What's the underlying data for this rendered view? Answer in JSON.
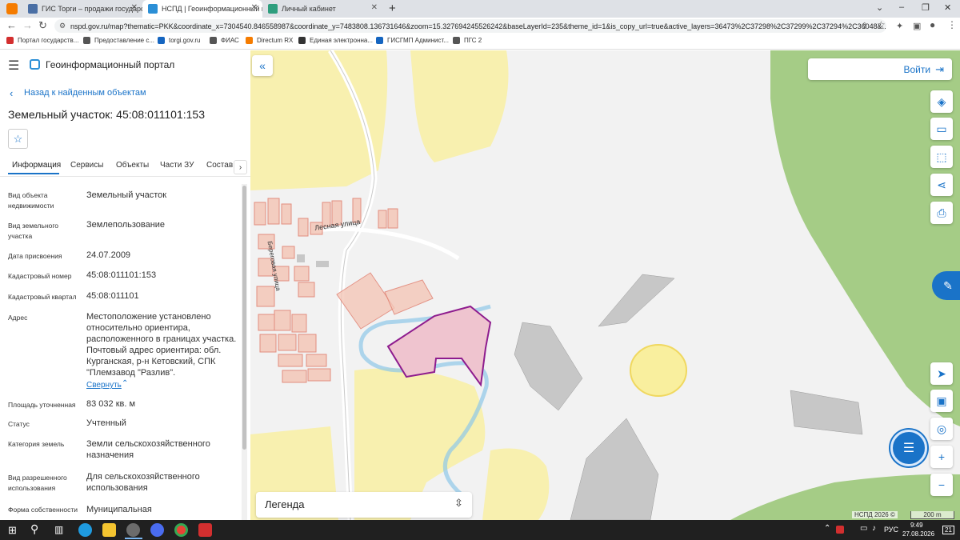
{
  "browser": {
    "tabs": [
      {
        "label": "ГИС Торги – продажи государс"
      },
      {
        "label": "НСПД | Геоинформационный п"
      },
      {
        "label": "Личный кабинет"
      }
    ],
    "new_tab": "+",
    "url": "nspd.gov.ru/map?thematic=PKK&coordinate_x=7304540.846558987&coordinate_y=7483808.136731646&zoom=15.327694245526242&baseLayerId=235&theme_id=1&is_copy_url=true&active_layers=36473%2C37298%2C37299%2C37294%2C36048&...",
    "bookmarks": [
      {
        "label": "Портал государств...",
        "color": "#d32f2f"
      },
      {
        "label": "Предоставление с...",
        "color": "#555"
      },
      {
        "label": "torgi.gov.ru",
        "color": "#1565c0"
      },
      {
        "label": "ФИАС",
        "color": "#555"
      },
      {
        "label": "Directum RX",
        "color": "#f57c00"
      },
      {
        "label": "Единая электронна...",
        "color": "#333"
      },
      {
        "label": "ГИСГМП Админист...",
        "color": "#1565c0"
      },
      {
        "label": "ПГС 2",
        "color": "#555"
      }
    ]
  },
  "app": {
    "title": "Геоинформационный портал",
    "back_link": "Назад к найденным объектам",
    "object_title": "Земельный участок: 45:08:011101:153",
    "tabs": [
      "Информация",
      "Сервисы",
      "Объекты",
      "Части ЗУ",
      "Состав"
    ],
    "collapse_link": "Свернуть"
  },
  "properties": [
    {
      "label": "Вид объекта недвижимости",
      "value": "Земельный участок"
    },
    {
      "label": "Вид земельного участка",
      "value": "Землепользование"
    },
    {
      "label": "Дата присвоения",
      "value": "24.07.2009"
    },
    {
      "label": "Кадастровый номер",
      "value": "45:08:011101:153"
    },
    {
      "label": "Кадастровый квартал",
      "value": "45:08:011101"
    },
    {
      "label": "Адрес",
      "value": "Местоположение установлено относительно ориентира, расположенного в границах участка. Почтовый адрес ориентира: обл. Курганская, р-н Кетовский, СПК \"Племзавод \"Разлив\"."
    },
    {
      "label": "Площадь уточненная",
      "value": "83 032 кв. м"
    },
    {
      "label": "Статус",
      "value": "Учтенный"
    },
    {
      "label": "Категория земель",
      "value": "Земли сельскохозяйственного назначения"
    },
    {
      "label": "Вид разрешенного использования",
      "value": "Для сельскохозяйственного использования"
    },
    {
      "label": "Форма собственности",
      "value": "Муниципальная"
    }
  ],
  "map": {
    "login_label": "Войти",
    "legend_label": "Легенда",
    "street_1": "Лесная улица",
    "street_2": "Береговая улица",
    "attribution": "НСПД 2026 ©",
    "scale": "200 m"
  },
  "taskbar": {
    "lang": "РУС",
    "time": "9:49",
    "date": "27.08.2026",
    "notif": "21"
  }
}
